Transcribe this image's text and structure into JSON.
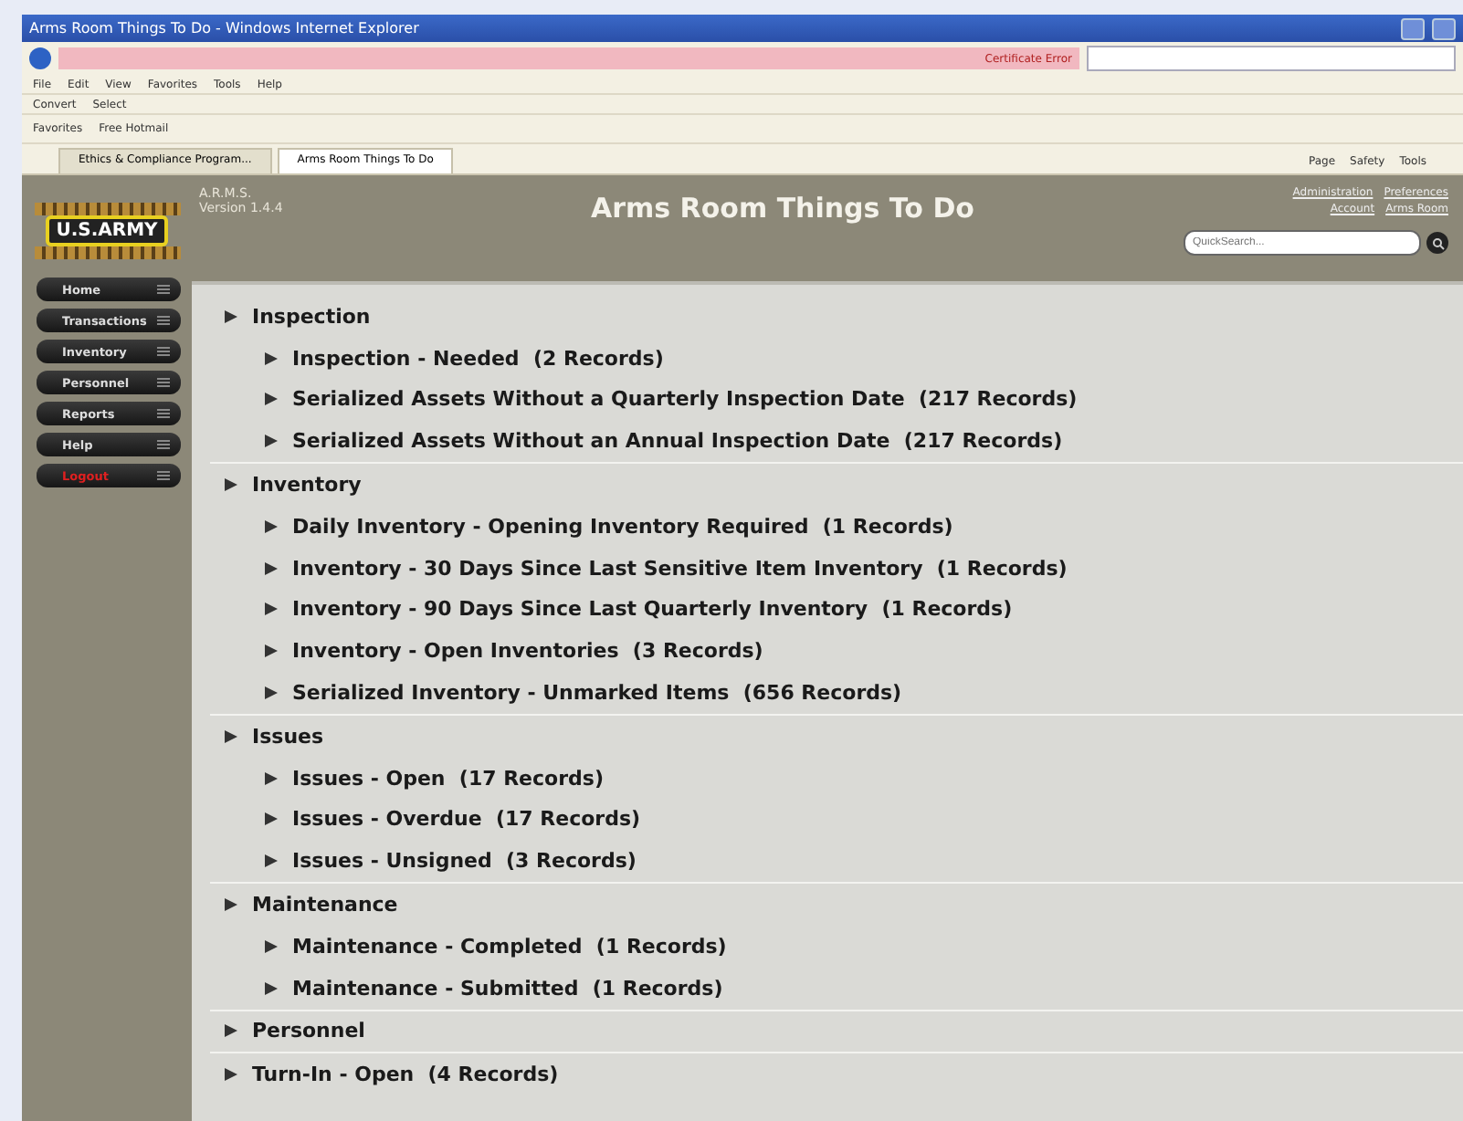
{
  "window": {
    "title": "Arms Room Things To Do - Windows Internet Explorer"
  },
  "address_bar": {
    "status": "Certificate Error"
  },
  "menu": [
    "File",
    "Edit",
    "View",
    "Favorites",
    "Tools",
    "Help"
  ],
  "toolbar": [
    "Convert",
    "Select"
  ],
  "favorites_bar": {
    "label": "Favorites",
    "links": [
      "Free Hotmail"
    ]
  },
  "tabs": [
    {
      "label": "Ethics & Compliance Program...",
      "selected": false
    },
    {
      "label": "Arms Room Things To Do",
      "selected": true
    }
  ],
  "command_bar": [
    "Page",
    "Safety",
    "Tools"
  ],
  "app": {
    "logo": "U.S.ARMY",
    "name": "A.R.M.S.",
    "version": "Version 1.4.4",
    "title": "Arms Room Things To Do",
    "header_links": [
      [
        "Administration",
        "Preferences"
      ],
      [
        "Account",
        "Arms Room"
      ]
    ],
    "search": {
      "placeholder": "QuickSearch..."
    }
  },
  "sidebar": {
    "items": [
      {
        "label": "Home",
        "kind": "normal"
      },
      {
        "label": "Transactions",
        "kind": "normal"
      },
      {
        "label": "Inventory",
        "kind": "normal"
      },
      {
        "label": "Personnel",
        "kind": "normal"
      },
      {
        "label": "Reports",
        "kind": "normal"
      },
      {
        "label": "Help",
        "kind": "normal"
      },
      {
        "label": "Logout",
        "kind": "danger"
      }
    ]
  },
  "sections": [
    {
      "title": "Inspection",
      "children": [
        {
          "title": "Inspection - Needed  (2 Records)"
        },
        {
          "title": "Serialized Assets Without a Quarterly Inspection Date  (217 Records)"
        },
        {
          "title": "Serialized Assets Without an Annual Inspection Date  (217 Records)"
        }
      ]
    },
    {
      "title": "Inventory",
      "children": [
        {
          "title": "Daily Inventory - Opening Inventory Required  (1 Records)"
        },
        {
          "title": "Inventory - 30 Days Since Last Sensitive Item Inventory  (1 Records)"
        },
        {
          "title": "Inventory - 90 Days Since Last Quarterly Inventory  (1 Records)"
        },
        {
          "title": "Inventory - Open Inventories  (3 Records)"
        },
        {
          "title": "Serialized Inventory - Unmarked Items  (656 Records)"
        }
      ]
    },
    {
      "title": "Issues",
      "children": [
        {
          "title": "Issues - Open  (17 Records)"
        },
        {
          "title": "Issues - Overdue  (17 Records)"
        },
        {
          "title": "Issues - Unsigned  (3 Records)"
        }
      ]
    },
    {
      "title": "Maintenance",
      "children": [
        {
          "title": "Maintenance - Completed  (1 Records)"
        },
        {
          "title": "Maintenance - Submitted  (1 Records)"
        }
      ]
    },
    {
      "title": "Personnel"
    },
    {
      "title": "Turn-In - Open  (4 Records)"
    }
  ]
}
